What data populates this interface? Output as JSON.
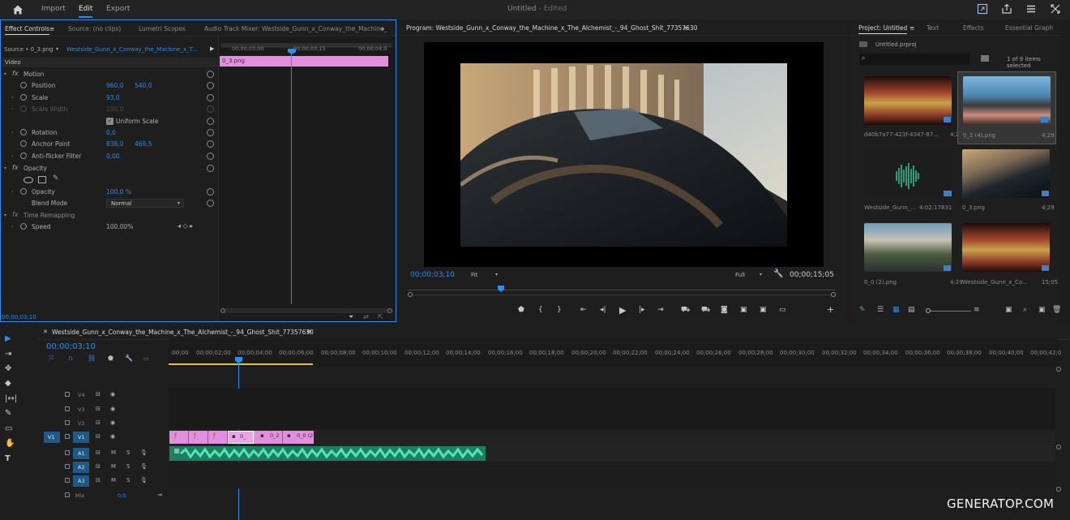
{
  "menubar": {
    "items": [
      "Import",
      "Edit",
      "Export"
    ],
    "title": "Untitled",
    "title_suffix": "- Edited"
  },
  "effect_controls": {
    "tabs": [
      "Effect Controls",
      "Source: (no clips)",
      "Lumetri Scopes",
      "Audio Track Mixer: Westside_Gunn_x_Conway_the_Machine_"
    ],
    "source_label": "Source • 0_3.png",
    "sequence_label": "Westside_Gunn_x_Conway_the_Machine_x_T...",
    "ruler_times": [
      "00;00;03;00",
      "00;00;03;15",
      "00;00;04;0"
    ],
    "clip_name": "0_3.png",
    "section_video": "Video",
    "motion": "Motion",
    "position_label": "Position",
    "position_x": "960,0",
    "position_y": "540,0",
    "scale_label": "Scale",
    "scale_value": "93,0",
    "scale_width_label": "Scale Width",
    "scale_width_value": "100,0",
    "uniform_scale": "Uniform Scale",
    "rotation_label": "Rotation",
    "rotation_value": "0,0",
    "anchor_label": "Anchor Point",
    "anchor_x": "838,0",
    "anchor_y": "469,5",
    "antiflicker_label": "Anti-flicker Filter",
    "antiflicker_value": "0,00",
    "opacity_section": "Opacity",
    "opacity_label": "Opacity",
    "opacity_value": "100,0 %",
    "blend_label": "Blend Mode",
    "blend_value": "Normal",
    "time_remap": "Time Remapping",
    "speed_label": "Speed",
    "speed_value": "100,00%",
    "timecode": "00;00;03;10"
  },
  "program": {
    "title": "Program: Westside_Gunn_x_Conway_the_Machine_x_The_Alchemist_-_94_Ghost_Shit_77357630",
    "timecode": "00;00;03;10",
    "fit": "Fit",
    "quality": "Full",
    "duration": "00;00;15;05"
  },
  "project": {
    "tabs": [
      "Project: Untitled",
      "Text",
      "Effects",
      "Essential Graph"
    ],
    "file": "Untitled.prproj",
    "count": "1 of 9 items selected",
    "items": [
      {
        "name": "d40b7a77-423f-4347-87...",
        "dur": "4;29"
      },
      {
        "name": "0_2 (4).png",
        "dur": "4;29"
      },
      {
        "name": "Westside_Gunn_...",
        "dur": "4:02:17831"
      },
      {
        "name": "0_3.png",
        "dur": "4;29"
      },
      {
        "name": "0_0 (2).png",
        "dur": "4;29"
      },
      {
        "name": "Westside_Gunn_x_Co...",
        "dur": "15;05"
      }
    ]
  },
  "timeline": {
    "tab": "Westside_Gunn_x_Conway_the_Machine_x_The_Alchemist_-_94_Ghost_Shit_77357630",
    "timecode": "00;00;03;10",
    "ruler": [
      ":00;00",
      "00;00;02;00",
      "00;00;04;00",
      "00;00;06;00",
      "00;00;08;00",
      "00;00;10;00",
      "00;00;12;00",
      "00;00;14;00",
      "00;00;16;00",
      "00;00;18;00",
      "00;00;20;00",
      "00;00;22;00",
      "00;00;24;00",
      "00;00;26;00",
      "00;00;28;00",
      "00;00;30;00",
      "00;00;32;00",
      "00;00;34;00",
      "00;00;36;00",
      "00;00;38;00",
      "00;00;40;00",
      "00;00;42;0"
    ],
    "tracks": [
      {
        "name": "V4",
        "patch": ""
      },
      {
        "name": "V3",
        "patch": ""
      },
      {
        "name": "V2",
        "patch": ""
      },
      {
        "name": "V1",
        "patch": "V1"
      },
      {
        "name": "A1",
        "patch": ""
      },
      {
        "name": "A2",
        "patch": ""
      },
      {
        "name": "A3",
        "patch": ""
      }
    ],
    "mix_label": "Mix",
    "mix_value": "0,0",
    "clips": [
      "0_",
      "0_2",
      "0_0 (2"
    ],
    "track_buttons": [
      "M",
      "S"
    ]
  },
  "watermark": "GENERATOP.COM",
  "colors": {
    "accent": "#2e8dea",
    "clip_pink": "#e38fe0",
    "audio_green": "#2fbf8e"
  }
}
